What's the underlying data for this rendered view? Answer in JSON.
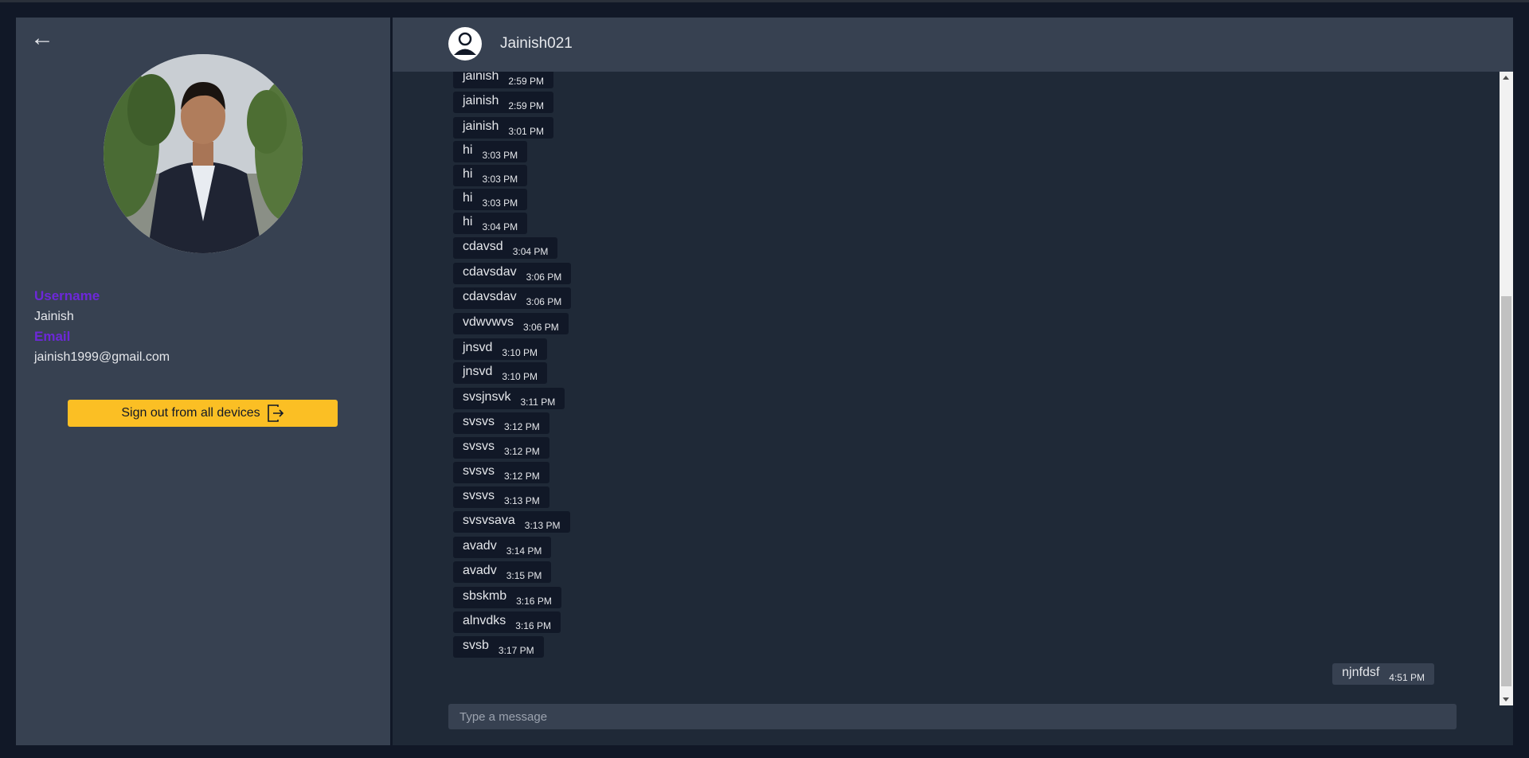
{
  "profile": {
    "username_label": "Username",
    "username": "Jainish",
    "email_label": "Email",
    "email": "jainish1999@gmail.com",
    "signout_label": "Sign out from all devices",
    "accent_color": "#6d28d9",
    "button_color": "#fbbf24"
  },
  "chat": {
    "contact_name": "Jainish021",
    "input_placeholder": "Type a message",
    "received": [
      {
        "text": "jainish",
        "time": "2:59 PM"
      },
      {
        "text": "jainish",
        "time": "2:59 PM"
      },
      {
        "text": "jainish",
        "time": "3:01 PM"
      },
      {
        "text": "hi",
        "time": "3:03 PM"
      },
      {
        "text": "hi",
        "time": "3:03 PM"
      },
      {
        "text": "hi",
        "time": "3:03 PM"
      },
      {
        "text": "hi",
        "time": "3:04 PM"
      },
      {
        "text": "cdavsd",
        "time": "3:04 PM"
      },
      {
        "text": "cdavsdav",
        "time": "3:06 PM"
      },
      {
        "text": "cdavsdav",
        "time": "3:06 PM"
      },
      {
        "text": "vdwvwvs",
        "time": "3:06 PM"
      },
      {
        "text": "jnsvd",
        "time": "3:10 PM"
      },
      {
        "text": "jnsvd",
        "time": "3:10 PM"
      },
      {
        "text": "svsjnsvk",
        "time": "3:11 PM"
      },
      {
        "text": "svsvs",
        "time": "3:12 PM"
      },
      {
        "text": "svsvs",
        "time": "3:12 PM"
      },
      {
        "text": "svsvs",
        "time": "3:12 PM"
      },
      {
        "text": "svsvs",
        "time": "3:13 PM"
      },
      {
        "text": "svsvsava",
        "time": "3:13 PM"
      },
      {
        "text": "avadv",
        "time": "3:14 PM"
      },
      {
        "text": "avadv",
        "time": "3:15 PM"
      },
      {
        "text": "sbskmb",
        "time": "3:16 PM"
      },
      {
        "text": "alnvdks",
        "time": "3:16 PM"
      },
      {
        "text": "svsb",
        "time": "3:17 PM"
      }
    ],
    "sent": [
      {
        "text": "njnfdsf",
        "time": "4:51 PM"
      }
    ]
  }
}
